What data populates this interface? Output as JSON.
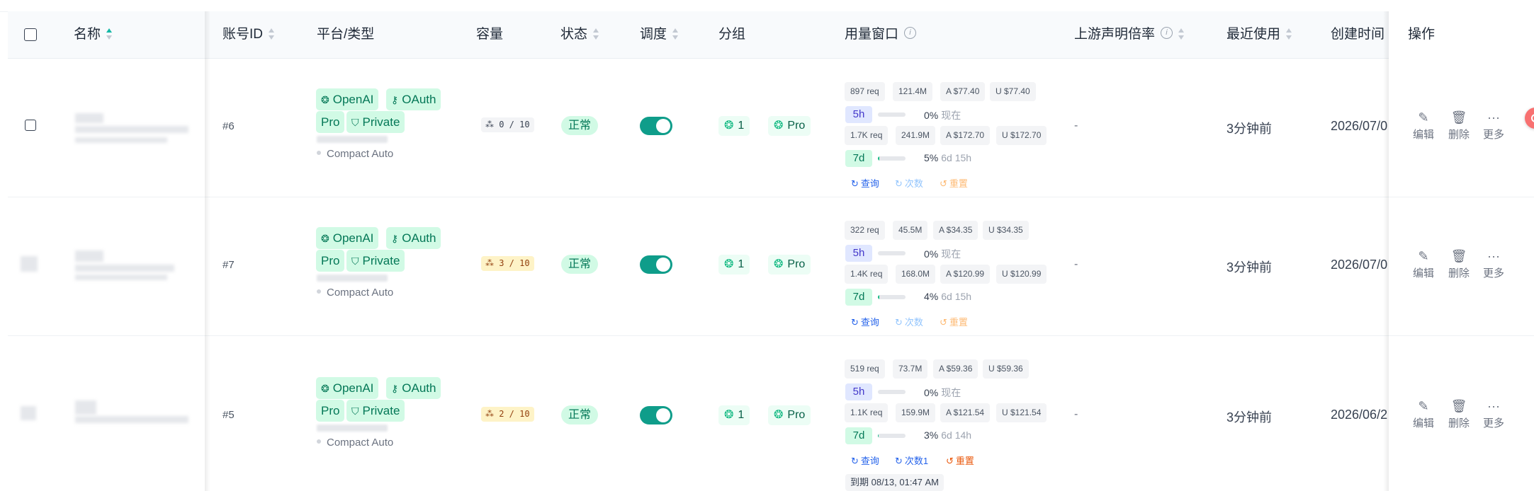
{
  "header": {
    "name": "名称",
    "account_id": "账号ID",
    "platform": "平台/类型",
    "capacity": "容量",
    "status": "状态",
    "schedule": "调度",
    "group": "分组",
    "usage_window": "用量窗口",
    "upstream_rate": "上游声明倍率",
    "last_used": "最近使用",
    "created_at": "创建时间",
    "actions": "操作"
  },
  "rows": [
    {
      "id": "#6",
      "platform_tags": [
        "OpenAI",
        "OAuth",
        "Pro",
        "Private"
      ],
      "compact": "Compact Auto",
      "capacity": "0 / 10",
      "capacity_color": "gray",
      "status": "正常",
      "schedule_on": true,
      "group_count": "1",
      "group_name": "Pro",
      "usage_5h": {
        "req": "897 req",
        "tokens": "121.4M",
        "a": "A $77.40",
        "u": "U $77.40",
        "label": "5h",
        "pct": "0%",
        "pct_value": 0,
        "remaining": "现在"
      },
      "usage_7d": {
        "req": "1.7K req",
        "tokens": "241.9M",
        "a": "A $172.70",
        "u": "U $172.70",
        "label": "7d",
        "pct": "5%",
        "pct_value": 5,
        "remaining": "6d 15h"
      },
      "actions_line": {
        "query": "查询",
        "count": "次数",
        "reset": "重置"
      },
      "upstream": "-",
      "last_used": "3分钟前",
      "created": "2026/07/0"
    },
    {
      "id": "#7",
      "platform_tags": [
        "OpenAI",
        "OAuth",
        "Pro",
        "Private"
      ],
      "compact": "Compact Auto",
      "capacity": "3 / 10",
      "capacity_color": "yellow",
      "status": "正常",
      "schedule_on": true,
      "group_count": "1",
      "group_name": "Pro",
      "usage_5h": {
        "req": "322 req",
        "tokens": "45.5M",
        "a": "A $34.35",
        "u": "U $34.35",
        "label": "5h",
        "pct": "0%",
        "pct_value": 0,
        "remaining": "现在"
      },
      "usage_7d": {
        "req": "1.4K req",
        "tokens": "168.0M",
        "a": "A $120.99",
        "u": "U $120.99",
        "label": "7d",
        "pct": "4%",
        "pct_value": 4,
        "remaining": "6d 15h"
      },
      "actions_line": {
        "query": "查询",
        "count": "次数",
        "reset": "重置"
      },
      "upstream": "-",
      "last_used": "3分钟前",
      "created": "2026/07/0"
    },
    {
      "id": "#5",
      "platform_tags": [
        "OpenAI",
        "OAuth",
        "Pro",
        "Private"
      ],
      "compact": "Compact Auto",
      "capacity": "2 / 10",
      "capacity_color": "yellow",
      "status": "正常",
      "schedule_on": true,
      "group_count": "1",
      "group_name": "Pro",
      "usage_5h": {
        "req": "519 req",
        "tokens": "73.7M",
        "a": "A $59.36",
        "u": "U $59.36",
        "label": "5h",
        "pct": "0%",
        "pct_value": 0,
        "remaining": "现在"
      },
      "usage_7d": {
        "req": "1.1K req",
        "tokens": "159.9M",
        "a": "A $121.54",
        "u": "U $121.54",
        "label": "7d",
        "pct": "3%",
        "pct_value": 3,
        "remaining": "6d 14h"
      },
      "actions_line": {
        "query": "查询",
        "count": "次数1",
        "reset": "重置"
      },
      "expire": "到期 08/13, 01:47 AM",
      "upstream": "-",
      "last_used": "3分钟前",
      "created": "2026/06/2"
    }
  ],
  "row_actions": {
    "edit": "编辑",
    "delete": "删除",
    "more": "更多"
  },
  "icons": {
    "openai": "openai-icon",
    "oauth": "key-icon",
    "private": "shield-icon",
    "edit": "edit-icon",
    "delete": "trash-icon",
    "more": "more-icon",
    "refresh": "refresh-icon",
    "reset": "reset-icon",
    "info": "info-icon"
  },
  "colors": {
    "accent": "#0f9d8a",
    "tag_bg": "#d1fae5",
    "tag_text": "#047857",
    "window_5h": "#e0e7ff",
    "window_7d": "#d1fae5"
  }
}
